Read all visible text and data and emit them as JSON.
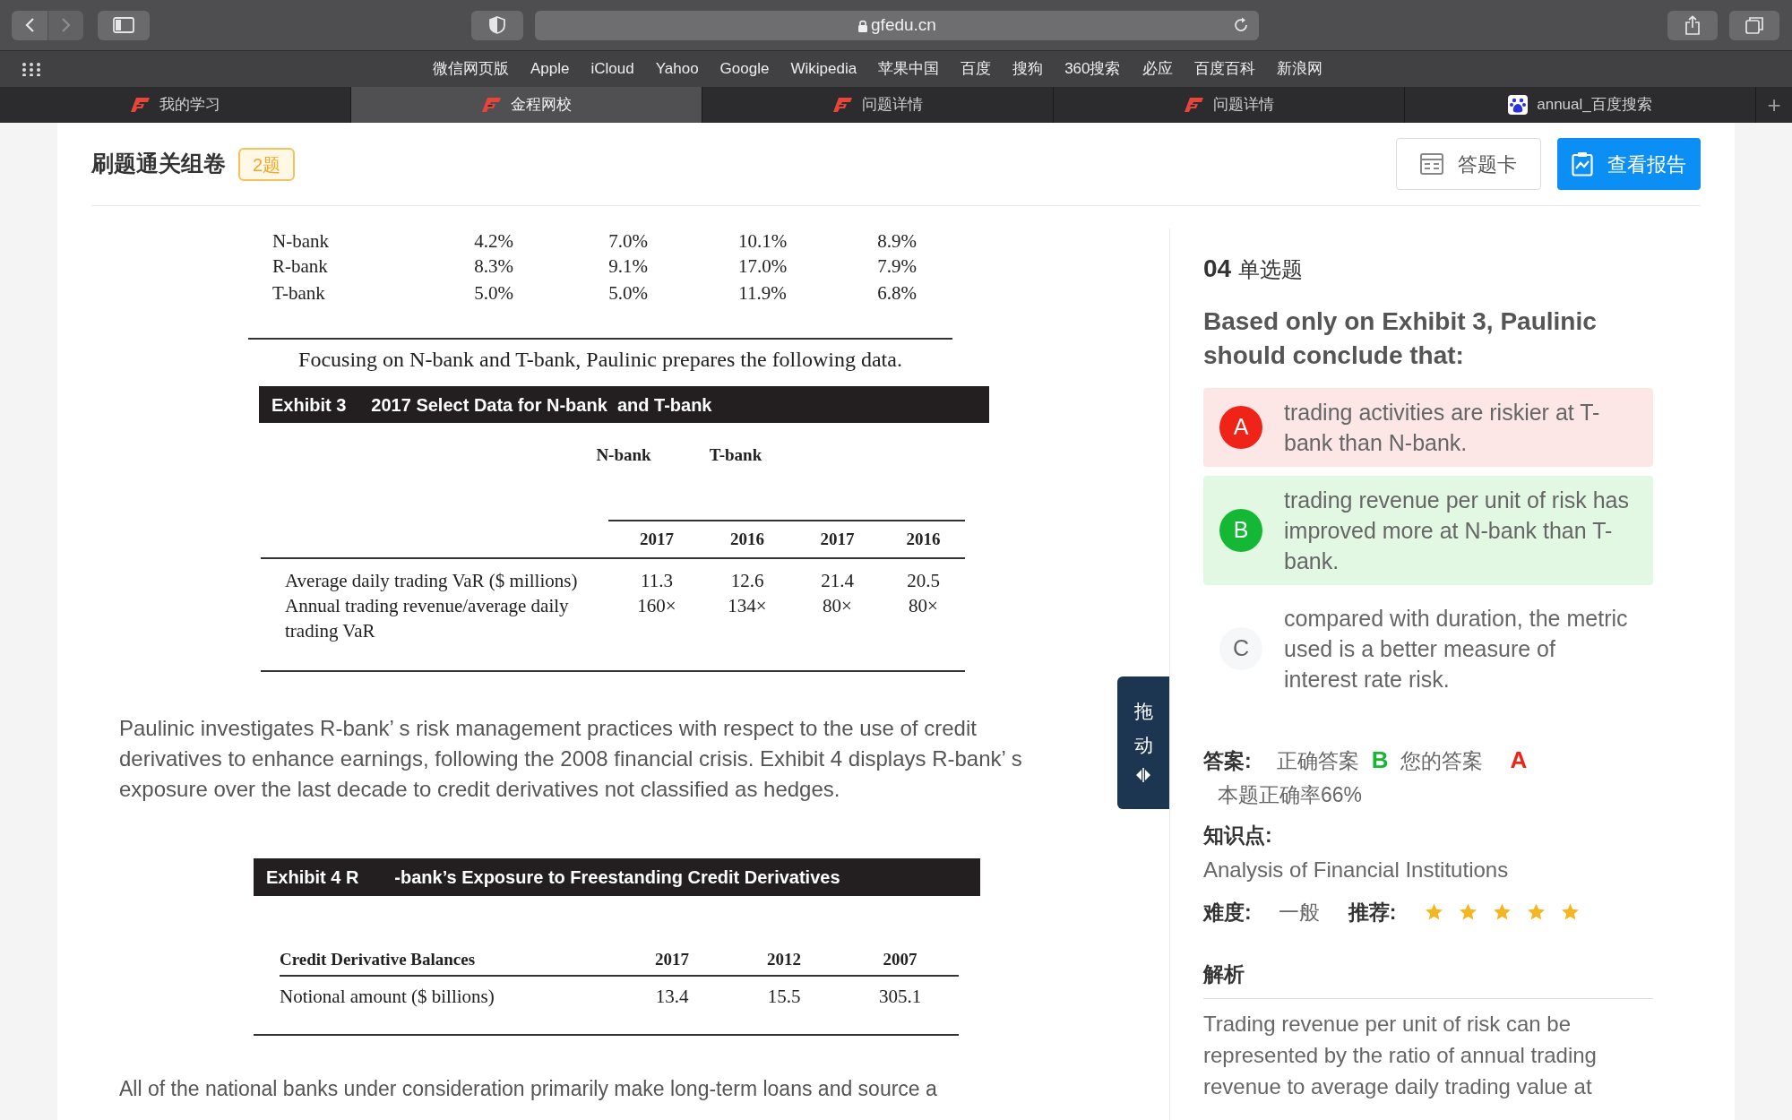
{
  "browser": {
    "url": "gfedu.cn",
    "bookmarks": [
      "微信网页版",
      "Apple",
      "iCloud",
      "Yahoo",
      "Google",
      "Wikipedia",
      "苹果中国",
      "百度",
      "搜狗",
      "360搜索",
      "必应",
      "百度百科",
      "新浪网"
    ],
    "tabs": [
      {
        "label": "我的学习",
        "kind": "site",
        "selected": false
      },
      {
        "label": "金程网校",
        "kind": "site",
        "selected": true
      },
      {
        "label": "问题详情",
        "kind": "site",
        "selected": false
      },
      {
        "label": "问题详情",
        "kind": "site",
        "selected": false
      },
      {
        "label": "annual_百度搜索",
        "kind": "search",
        "selected": false
      }
    ],
    "new_tab": "+"
  },
  "header": {
    "title": "刷题通关组卷",
    "badge": "2题",
    "buttons": [
      {
        "label": "答题卡",
        "kind": "card"
      },
      {
        "label": "查看报告",
        "kind": "report"
      }
    ]
  },
  "document": {
    "top_table": {
      "rows": [
        [
          "N-bank",
          "4.2%",
          "7.0%",
          "10.1%",
          "8.9%"
        ],
        [
          "R-bank",
          "8.3%",
          "9.1%",
          "17.0%",
          "7.9%"
        ],
        [
          "T-bank",
          "5.0%",
          "5.0%",
          "11.9%",
          "6.8%"
        ]
      ]
    },
    "note": "Focusing on N-bank and T-bank, Paulinic prepares the following data.",
    "exhibit_3": {
      "label": "Exhibit 3",
      "title": "2017 Select Data for N-bank  and T-bank",
      "groups": [
        "N-bank",
        "T-bank"
      ],
      "years": [
        "2017",
        "2016",
        "2017",
        "2016"
      ],
      "rows": [
        [
          "Average daily trading VaR ($ millions)",
          "11.3",
          "12.6",
          "21.4",
          "20.5"
        ],
        [
          "Annual trading revenue/average daily trading VaR",
          "160×",
          "134×",
          "80×",
          "80×"
        ]
      ]
    },
    "paragraph": "Paulinic investigates R-bank’ s risk management practices with respect to the use of credit derivatives to enhance earnings, following the 2008 financial crisis. Exhibit 4 displays R-bank’ s exposure over the last decade to credit derivatives not classified as hedges.",
    "exhibit_4": {
      "label": "Exhibit 4 R",
      "title": "-bank’s Exposure to Freestanding Credit Derivatives",
      "columns": [
        "Credit Derivative Balances",
        "2017",
        "2012",
        "2007"
      ],
      "rows": [
        [
          "Notional amount ($ billions)",
          "13.4",
          "15.5",
          "305.1"
        ]
      ]
    },
    "paragraph_2": "All of the national banks under consideration primarily make long-term loans and source a"
  },
  "drag_handle": {
    "label": "拖动"
  },
  "question": {
    "number": "04",
    "type": "单选题",
    "text": "Based only on Exhibit 3, Paulinic should conclude that:",
    "options": [
      {
        "letter": "A",
        "text": "trading activities are riskier at T-bank than N-bank.",
        "selected": true,
        "correct": false
      },
      {
        "letter": "B",
        "text": "trading revenue per unit of risk has improved more at N-bank than T-bank.",
        "selected": false,
        "correct": true
      },
      {
        "letter": "C",
        "text": "compared with duration, the metric used is a better measure of interest rate risk.",
        "selected": false,
        "correct": false
      }
    ],
    "answer": {
      "label": "答案:",
      "correct_label": "正确答案",
      "correct": "B",
      "yours_label": "您的答案",
      "yours": "A",
      "rate": "本题正确率66%"
    },
    "knowledge": {
      "label": "知识点:",
      "value": "Analysis of Financial Institutions"
    },
    "difficulty": {
      "label": "难度:",
      "value": "一般"
    },
    "recommend": {
      "label": "推荐:",
      "stars": 5
    },
    "analysis": {
      "heading": "解析",
      "text": "Trading revenue per unit of risk can be represented by the ratio of annual trading revenue to average daily trading value at"
    }
  }
}
